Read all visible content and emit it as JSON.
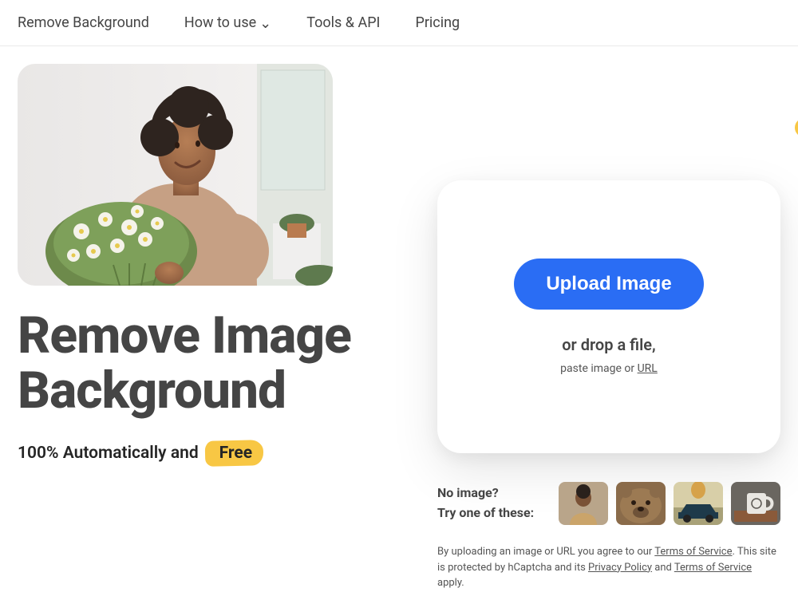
{
  "nav": {
    "remove_background": "Remove Background",
    "how_to_use": "How to use",
    "tools_api": "Tools & API",
    "pricing": "Pricing"
  },
  "hero": {
    "headline": "Remove Image Background",
    "subline_prefix": "100% Automatically and",
    "free_label": "Free"
  },
  "upload": {
    "button": "Upload Image",
    "drop_text": "or drop a file,",
    "paste_prefix": "paste image or ",
    "url_label": "URL"
  },
  "examples": {
    "no_image": "No image?",
    "try_one": "Try one of these:",
    "thumbs": [
      "person",
      "bear",
      "car",
      "mug"
    ]
  },
  "legal": {
    "prefix": "By uploading an image or URL you agree to our ",
    "tos": "Terms of Service",
    "mid": ". This site is protected by hCaptcha and its ",
    "privacy": "Privacy Policy",
    "and": " and ",
    "tos2": "Terms of Service",
    "suffix": " apply."
  }
}
